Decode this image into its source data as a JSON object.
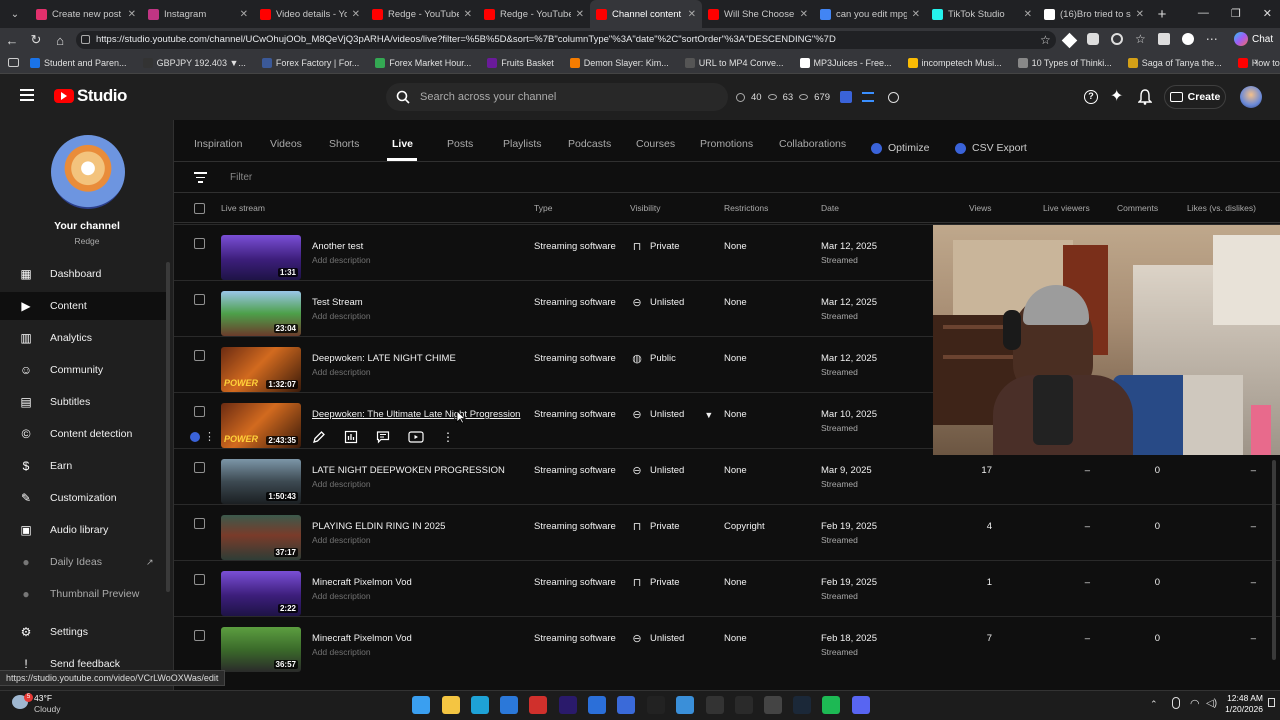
{
  "browser": {
    "tabs": [
      {
        "title": "Create new post • In",
        "color": "#e1306c"
      },
      {
        "title": "Instagram",
        "color": "#c13584"
      },
      {
        "title": "Video details - YouTu",
        "color": "#ff0000"
      },
      {
        "title": "Redge - YouTube",
        "color": "#ff0000"
      },
      {
        "title": "Redge - YouTube",
        "color": "#ff0000"
      },
      {
        "title": "Channel content - Yo",
        "color": "#ff0000"
      },
      {
        "title": "Will She Choose A Li",
        "color": "#ff0000"
      },
      {
        "title": "can you edit mpg fil",
        "color": "#4285f4"
      },
      {
        "title": "TikTok Studio",
        "color": "#25f4ee"
      },
      {
        "title": "(16)Bro tried to snea",
        "color": "#ffffff"
      }
    ],
    "url": "https://studio.youtube.com/channel/UCwOhujOOb_M8QeVjQ3pARHA/videos/live?filter=%5B%5D&sort=%7B\"columnType\"%3A\"date\"%2C\"sortOrder\"%3A\"DESCENDING\"%7D",
    "chat_label": "Chat",
    "bookmarks": [
      {
        "label": "Student and Paren...",
        "color": "#1a73e8"
      },
      {
        "label": "GBPJPY 192.403 ▼...",
        "color": "#333333"
      },
      {
        "label": "Forex Factory | For...",
        "color": "#3b5998"
      },
      {
        "label": "Forex Market Hour...",
        "color": "#34a853"
      },
      {
        "label": "Fruits Basket",
        "color": "#6a1b9a"
      },
      {
        "label": "Demon Slayer: Kim...",
        "color": "#f57c00"
      },
      {
        "label": "URL to MP4 Conve...",
        "color": "#555555"
      },
      {
        "label": "MP3Juices - Free...",
        "color": "#ffffff"
      },
      {
        "label": "incompetech Musi...",
        "color": "#fbbc04"
      },
      {
        "label": "10 Types of Thinki...",
        "color": "#888888"
      },
      {
        "label": "Saga of Tanya the...",
        "color": "#d4a017"
      },
      {
        "label": "How to Fix Screen...",
        "color": "#ff0000"
      }
    ]
  },
  "studio": {
    "logo_text": "Studio",
    "search_placeholder": "Search across your channel",
    "stats": {
      "a": "40",
      "b": "63",
      "c": "679"
    },
    "create_label": "Create"
  },
  "sidebar": {
    "channel_label": "Your channel",
    "channel_name": "Redge",
    "items": [
      {
        "label": "Dashboard",
        "icon": "dashboard-icon"
      },
      {
        "label": "Content",
        "icon": "content-icon"
      },
      {
        "label": "Analytics",
        "icon": "analytics-icon"
      },
      {
        "label": "Community",
        "icon": "community-icon"
      },
      {
        "label": "Subtitles",
        "icon": "subtitles-icon"
      },
      {
        "label": "Content detection",
        "icon": "copyright-icon"
      },
      {
        "label": "Earn",
        "icon": "earn-icon"
      },
      {
        "label": "Customization",
        "icon": "customization-icon"
      },
      {
        "label": "Audio library",
        "icon": "audio-library-icon"
      },
      {
        "label": "Daily Ideas",
        "icon": "ideas-icon"
      },
      {
        "label": "Thumbnail Preview",
        "icon": "thumbnail-preview-icon"
      },
      {
        "label": "Settings",
        "icon": "settings-icon"
      },
      {
        "label": "Send feedback",
        "icon": "feedback-icon"
      }
    ]
  },
  "content_tabs": [
    "Inspiration",
    "Videos",
    "Shorts",
    "Live",
    "Posts",
    "Playlists",
    "Podcasts",
    "Courses",
    "Promotions",
    "Collaborations",
    "Optimize",
    "CSV Export"
  ],
  "filter_placeholder": "Filter",
  "columns": {
    "live_stream": "Live stream",
    "type": "Type",
    "visibility": "Visibility",
    "restrictions": "Restrictions",
    "date": "Date",
    "views": "Views",
    "live_viewers": "Live viewers",
    "comments": "Comments",
    "likes": "Likes (vs. dislikes)"
  },
  "rows": [
    {
      "title": "Another test",
      "desc": "Add description",
      "duration": "1:31",
      "type": "Streaming software",
      "visibility": "Private",
      "restrictions": "None",
      "date": "Mar 12, 2025",
      "status": "Streamed",
      "views": "",
      "live_viewers": "",
      "comments": "",
      "likes": "",
      "thumb": "purple"
    },
    {
      "title": "Test Stream",
      "desc": "Add description",
      "duration": "23:04",
      "type": "Streaming software",
      "visibility": "Unlisted",
      "restrictions": "None",
      "date": "Mar 12, 2025",
      "status": "Streamed",
      "views": "",
      "live_viewers": "",
      "comments": "",
      "likes": "",
      "thumb": "game"
    },
    {
      "title": "Deepwoken: LATE NIGHT CHIME",
      "desc": "Add description",
      "duration": "1:32:07",
      "type": "Streaming software",
      "visibility": "Public",
      "restrictions": "None",
      "date": "Mar 12, 2025",
      "status": "Streamed",
      "views": "",
      "live_viewers": "",
      "comments": "",
      "likes": "",
      "thumb": "power"
    },
    {
      "title": "Deepwoken: The Ultimate Late Night Progression",
      "desc": "",
      "duration": "2:43:35",
      "type": "Streaming software",
      "visibility": "Unlisted",
      "restrictions": "None",
      "date": "Mar 10, 2025",
      "status": "Streamed",
      "views": "",
      "live_viewers": "",
      "comments": "",
      "likes": "",
      "thumb": "power"
    },
    {
      "title": "LATE NIGHT DEEPWOKEN PROGRESSION",
      "desc": "Add description",
      "duration": "1:50:43",
      "type": "Streaming software",
      "visibility": "Unlisted",
      "restrictions": "None",
      "date": "Mar 9, 2025",
      "status": "Streamed",
      "views": "17",
      "live_viewers": "–",
      "comments": "0",
      "likes": "–",
      "thumb": "dark"
    },
    {
      "title": "PLAYING ELDIN RING IN 2025",
      "desc": "Add description",
      "duration": "37:17",
      "type": "Streaming software",
      "visibility": "Private",
      "restrictions": "Copyright",
      "date": "Feb 19, 2025",
      "status": "Streamed",
      "views": "4",
      "live_viewers": "–",
      "comments": "0",
      "likes": "–",
      "thumb": "elden"
    },
    {
      "title": "Minecraft Pixelmon Vod",
      "desc": "Add description",
      "duration": "2:22",
      "type": "Streaming software",
      "visibility": "Private",
      "restrictions": "None",
      "date": "Feb 19, 2025",
      "status": "Streamed",
      "views": "1",
      "live_viewers": "–",
      "comments": "0",
      "likes": "–",
      "thumb": "purple"
    },
    {
      "title": "Minecraft Pixelmon Vod",
      "desc": "Add description",
      "duration": "36:57",
      "type": "Streaming software",
      "visibility": "Unlisted",
      "restrictions": "None",
      "date": "Feb 18, 2025",
      "status": "Streamed",
      "views": "7",
      "live_viewers": "–",
      "comments": "0",
      "likes": "–",
      "thumb": "mc"
    }
  ],
  "status_url": "https://studio.youtube.com/video/VCrLWoOXWas/edit",
  "taskbar": {
    "temp": "43°F",
    "weather": "Cloudy",
    "time": "12:48 AM",
    "date": "1/20/2026"
  },
  "colors": {
    "accent": "#3ea6ff",
    "youtube_red": "#ff0000",
    "background": "#0f0f0f",
    "sidebar": "#1f1f1f"
  }
}
